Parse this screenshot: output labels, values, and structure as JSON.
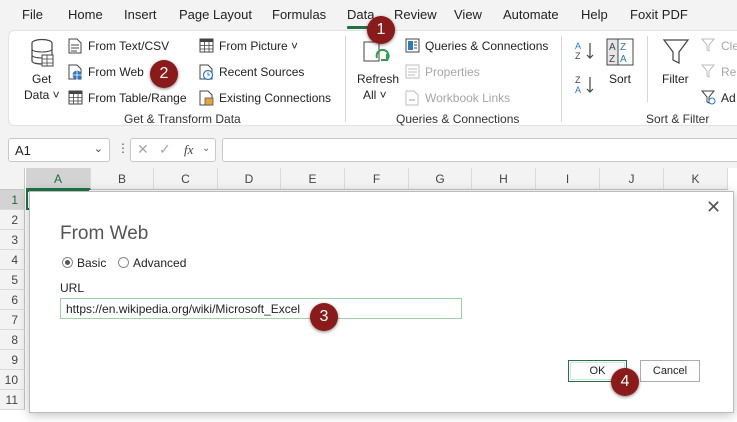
{
  "menu": [
    "File",
    "Home",
    "Insert",
    "Page Layout",
    "Formulas",
    "Data",
    "Review",
    "View",
    "Automate",
    "Help",
    "Foxit PDF"
  ],
  "active_tab": "Data",
  "ribbon": {
    "get_data": {
      "line1": "Get",
      "line2": "Data ˅"
    },
    "from_text_csv": "From Text/CSV",
    "from_web": "From Web",
    "from_table_range": "From Table/Range",
    "from_picture": "From Picture ˅",
    "recent_sources": "Recent Sources",
    "existing_connections": "Existing Connections",
    "group_get_transform": "Get & Transform Data",
    "refresh_all": {
      "line1": "Refresh",
      "line2": "All ˅"
    },
    "queries_connections": "Queries & Connections",
    "properties": "Properties",
    "workbook_links": "Workbook Links",
    "group_queries": "Queries & Connections",
    "sort": "Sort",
    "filter": "Filter",
    "clear": "Cle",
    "reapply": "Re",
    "advanced": "Ad",
    "group_sort_filter": "Sort & Filter"
  },
  "formula_bar": {
    "name_box": "A1",
    "fx": "fx",
    "formula": ""
  },
  "grid": {
    "columns": [
      "A",
      "B",
      "C",
      "D",
      "E",
      "F",
      "G",
      "H",
      "I",
      "J",
      "K"
    ],
    "rows": [
      "1",
      "2",
      "3",
      "4",
      "5",
      "6",
      "7",
      "8",
      "9",
      "10",
      "11"
    ]
  },
  "dialog": {
    "title": "From Web",
    "close": "✕",
    "radio_basic": "Basic",
    "radio_advanced": "Advanced",
    "url_label": "URL",
    "url_value": "https://en.wikipedia.org/wiki/Microsoft_Excel",
    "ok": "OK",
    "cancel": "Cancel"
  },
  "callouts": [
    "1",
    "2",
    "3",
    "4"
  ],
  "colors": {
    "accent": "#217346",
    "callout": "#8b1a1a"
  }
}
